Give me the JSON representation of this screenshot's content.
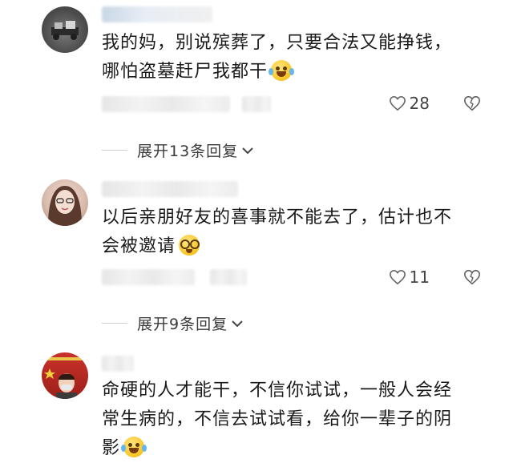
{
  "comments": [
    {
      "text_line1": "我的妈，别说殡葬了，只要合法又能挣钱，",
      "text_line2": "哪怕盗墓赶尸我都干",
      "emoji": "crying-laughing-emoji",
      "like_count": "28",
      "expand_label": "展开13条回复"
    },
    {
      "text_line1": "以后亲朋好友的喜事就不能去了，估计也不",
      "text_line2": "会被邀请",
      "emoji": "dizzy-eyes-emoji",
      "like_count": "11",
      "expand_label": "展开9条回复"
    },
    {
      "text_line1": "命硬的人才能干，不信你试试，一般人会经",
      "text_line2": "常生病的，不信去试试看，给你一辈子的阴",
      "text_line3": "影",
      "emoji": "crying-laughing-emoji"
    }
  ],
  "icons": {
    "like": "heart-outline-icon",
    "dislike": "broken-heart-outline-icon",
    "expand": "chevron-down-icon"
  },
  "colors": {
    "text": "#1a1a1a",
    "secondary": "#3a3a3a",
    "icon": "#555555"
  }
}
